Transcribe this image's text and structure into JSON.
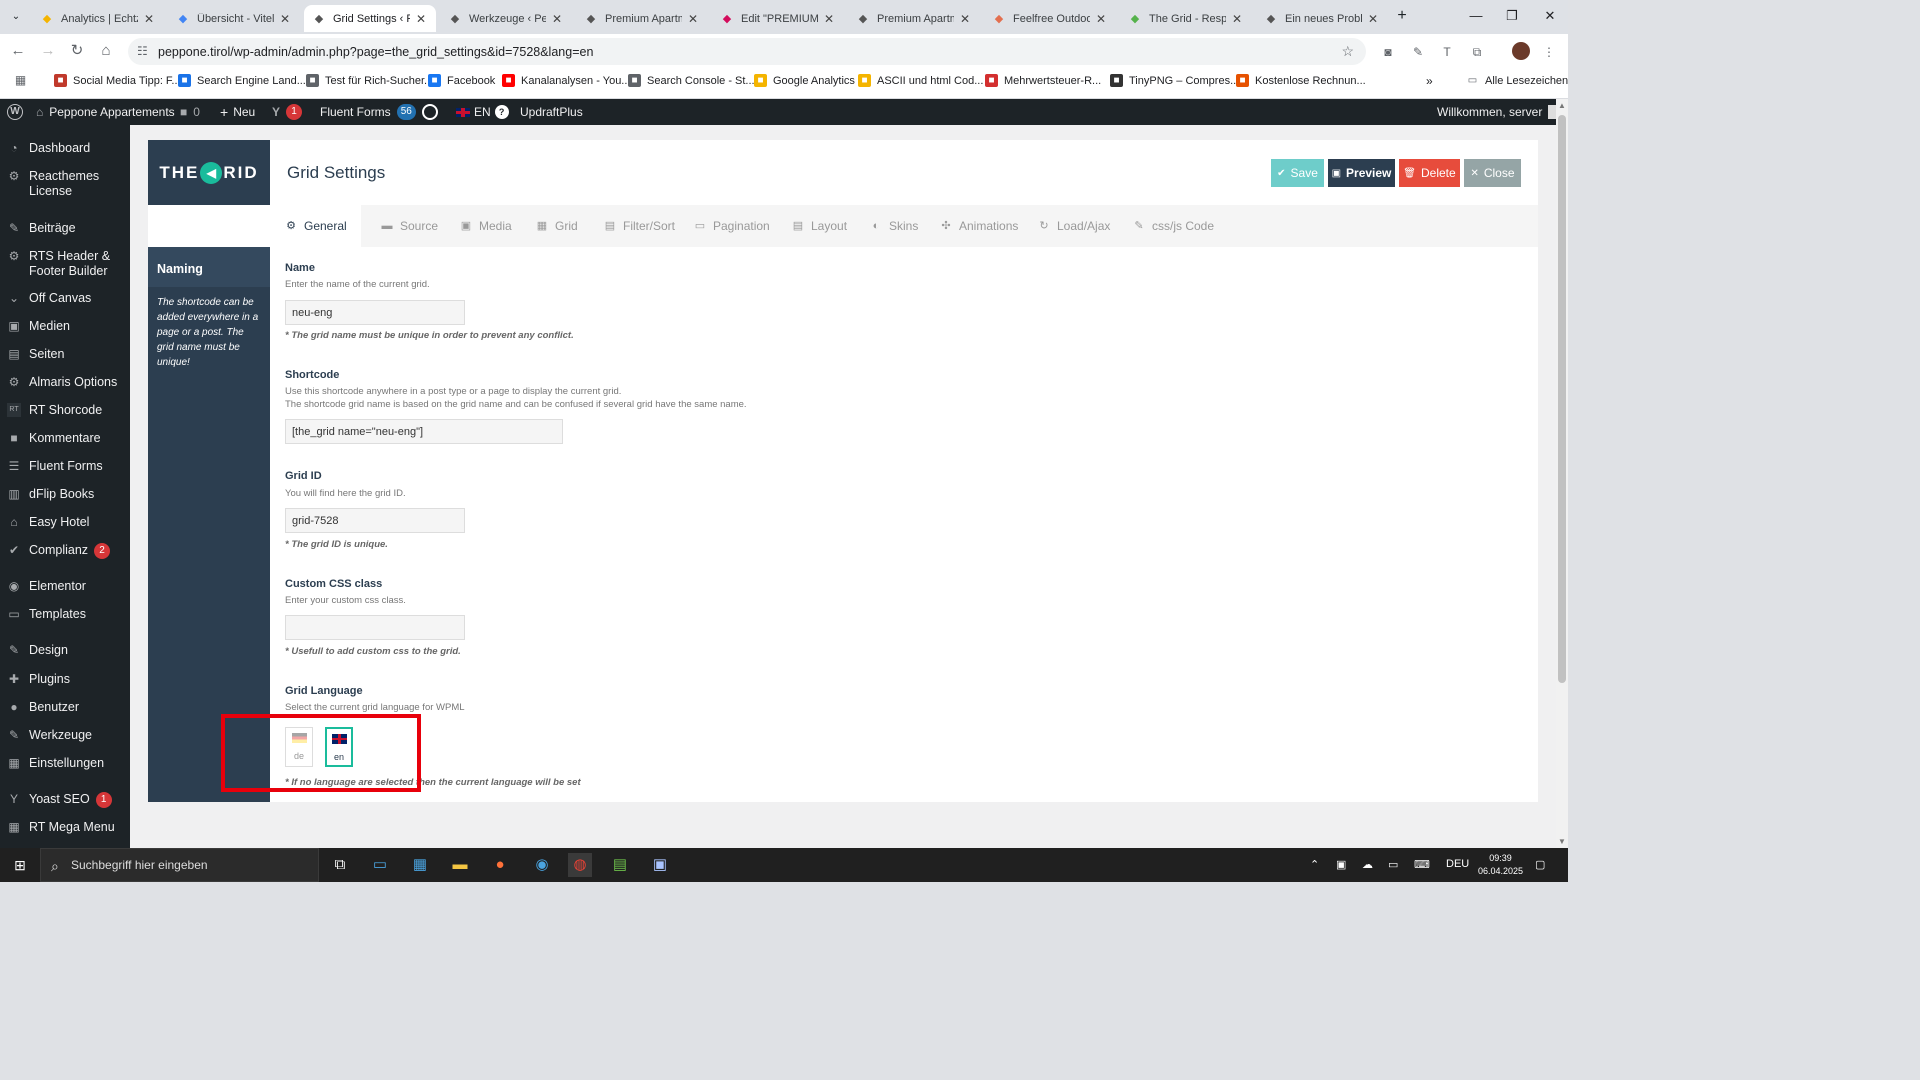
{
  "browser": {
    "tabs": [
      {
        "title": "Analytics | Echtzeit",
        "icon": "analytics-icon",
        "color": "#f4b400"
      },
      {
        "title": "Übersicht - Vitelly",
        "icon": "google-ads-icon",
        "color": "#4285f4"
      },
      {
        "title": "Grid Settings ‹ Pe",
        "icon": "feather-icon",
        "color": "#555555"
      },
      {
        "title": "Werkzeuge ‹ Pepp",
        "icon": "feather-icon",
        "color": "#555555"
      },
      {
        "title": "Premium Apartm",
        "icon": "feather-icon",
        "color": "#555555"
      },
      {
        "title": "Edit \"PREMIUM A",
        "icon": "elementor-icon",
        "color": "#d30c5c"
      },
      {
        "title": "Premium Apartm",
        "icon": "feather-icon",
        "color": "#555555"
      },
      {
        "title": "Feelfree Outdoor",
        "icon": "outdoor-icon",
        "color": "#e36f4f"
      },
      {
        "title": "The Grid - Respon",
        "icon": "grid-plugin-icon",
        "color": "#55b24b"
      },
      {
        "title": "Ein neues Problem",
        "icon": "support-icon",
        "color": "#555555"
      }
    ],
    "active_tab": 2,
    "url": "peppone.tirol/wp-admin/admin.php?page=the_grid_settings&id=7528&lang=en",
    "bookmarks": [
      {
        "label": "Social Media Tipp: F...",
        "icon": "k-icon",
        "color": "#c0392b"
      },
      {
        "label": "Search Engine Land...",
        "icon": "sel-icon",
        "color": "#1a73e8"
      },
      {
        "label": "Test für Rich-Sucher...",
        "icon": "rich-results-icon",
        "color": "#5f6368"
      },
      {
        "label": "Facebook",
        "icon": "facebook-icon",
        "color": "#1877f2"
      },
      {
        "label": "Kanalanalysen - You...",
        "icon": "youtube-icon",
        "color": "#ff0000"
      },
      {
        "label": "Search Console - St...",
        "icon": "search-console-icon",
        "color": "#5f6368"
      },
      {
        "label": "Google Analytics",
        "icon": "analytics-icon",
        "color": "#f4b400"
      },
      {
        "label": "ASCII und html Cod...",
        "icon": "m-icon",
        "color": "#f4b400"
      },
      {
        "label": "Mehrwertsteuer-R...",
        "icon": "opera-icon",
        "color": "#d32f2f"
      },
      {
        "label": "TinyPNG – Compres...",
        "icon": "panda-icon",
        "color": "#333333"
      },
      {
        "label": "Kostenlose Rechnun...",
        "icon": "x-icon",
        "color": "#e65100"
      }
    ],
    "all_bookmarks": "Alle Lesezeichen"
  },
  "adminbar": {
    "site": "Peppone Appartements",
    "comments": "0",
    "new": "Neu",
    "yoast_count": "1",
    "fluent_forms": "Fluent Forms",
    "fluent_count": "56",
    "lang": "EN",
    "updraft": "UpdraftPlus",
    "welcome": "Willkommen, server"
  },
  "sidebar": [
    {
      "label": "Dashboard",
      "icon": "dashboard-icon"
    },
    {
      "label": "Reacthemes License",
      "icon": "gear-icon"
    },
    {
      "label": "Beiträge",
      "icon": "pin-icon"
    },
    {
      "label": "RTS Header & Footer Builder",
      "icon": "gear-icon"
    },
    {
      "label": "Off Canvas",
      "icon": "chevron-down-icon"
    },
    {
      "label": "Medien",
      "icon": "media-icon"
    },
    {
      "label": "Seiten",
      "icon": "pages-icon"
    },
    {
      "label": "Almaris Options",
      "icon": "gear-icon"
    },
    {
      "label": "RT Shorcode",
      "icon": "rt-icon"
    },
    {
      "label": "Kommentare",
      "icon": "comment-icon"
    },
    {
      "label": "Fluent Forms",
      "icon": "forms-icon"
    },
    {
      "label": "dFlip Books",
      "icon": "book-icon"
    },
    {
      "label": "Easy Hotel",
      "icon": "hotel-icon"
    },
    {
      "label": "Complianz",
      "icon": "check-icon",
      "badge": "2"
    },
    {
      "label": "Elementor",
      "icon": "elementor-icon"
    },
    {
      "label": "Templates",
      "icon": "folder-icon"
    },
    {
      "label": "Design",
      "icon": "brush-icon"
    },
    {
      "label": "Plugins",
      "icon": "plugin-icon"
    },
    {
      "label": "Benutzer",
      "icon": "user-icon"
    },
    {
      "label": "Werkzeuge",
      "icon": "wrench-icon"
    },
    {
      "label": "Einstellungen",
      "icon": "settings-icon"
    },
    {
      "label": "Yoast SEO",
      "icon": "yoast-icon",
      "badge": "1"
    },
    {
      "label": "RT Mega Menu",
      "icon": "menu-icon"
    }
  ],
  "grid": {
    "logo_left": "THE",
    "logo_right": "RID",
    "title": "Grid Settings",
    "buttons": {
      "save": "Save",
      "preview": "Preview",
      "delete": "Delete",
      "close": "Close"
    },
    "colors": {
      "save": "#6ecdca",
      "preview": "#2c3e50",
      "delete": "#e74c3c",
      "close": "#95a5a6",
      "accent": "#1abc9c"
    },
    "tabs": [
      {
        "label": "General",
        "icon": "gear-icon"
      },
      {
        "label": "Source",
        "icon": "folder-icon"
      },
      {
        "label": "Media",
        "icon": "image-icon"
      },
      {
        "label": "Grid",
        "icon": "grid-icon"
      },
      {
        "label": "Filter/Sort",
        "icon": "filter-icon"
      },
      {
        "label": "Pagination",
        "icon": "pagination-icon"
      },
      {
        "label": "Layout",
        "icon": "layout-icon"
      },
      {
        "label": "Skins",
        "icon": "skins-icon"
      },
      {
        "label": "Animations",
        "icon": "animations-icon"
      },
      {
        "label": "Load/Ajax",
        "icon": "refresh-icon"
      },
      {
        "label": "css/js Code",
        "icon": "wrench-icon"
      }
    ],
    "section": {
      "title": "Naming",
      "description": "The shortcode can be added everywhere in a page or a post. The grid name must be unique!"
    },
    "fields": {
      "name": {
        "label": "Name",
        "desc": "Enter the name of the current grid.",
        "value": "neu-eng",
        "note": "* The grid name must be unique in order to prevent any conflict."
      },
      "shortcode": {
        "label": "Shortcode",
        "desc1": "Use this shortcode anywhere in a post type or a page to display the current grid.",
        "desc2": "The shortcode grid name is based on the grid name and can be confused if several grid have the same name.",
        "value": "[the_grid name=\"neu-eng\"]"
      },
      "gridid": {
        "label": "Grid ID",
        "desc": "You will find here the grid ID.",
        "value": "grid-7528",
        "note": "* The grid ID is unique."
      },
      "css": {
        "label": "Custom CSS class",
        "desc": "Enter your custom css class.",
        "value": "",
        "note": "* Usefull to add custom css to the grid."
      },
      "language": {
        "label": "Grid Language",
        "desc": "Select the current grid language for WPML",
        "options": [
          "de",
          "en"
        ],
        "selected": "en",
        "note": "* If no language are selected then the current language will be set"
      }
    }
  },
  "taskbar": {
    "search_placeholder": "Suchbegriff hier eingeben",
    "lang": "DEU",
    "time": "09:39",
    "date": "06.04.2025"
  }
}
